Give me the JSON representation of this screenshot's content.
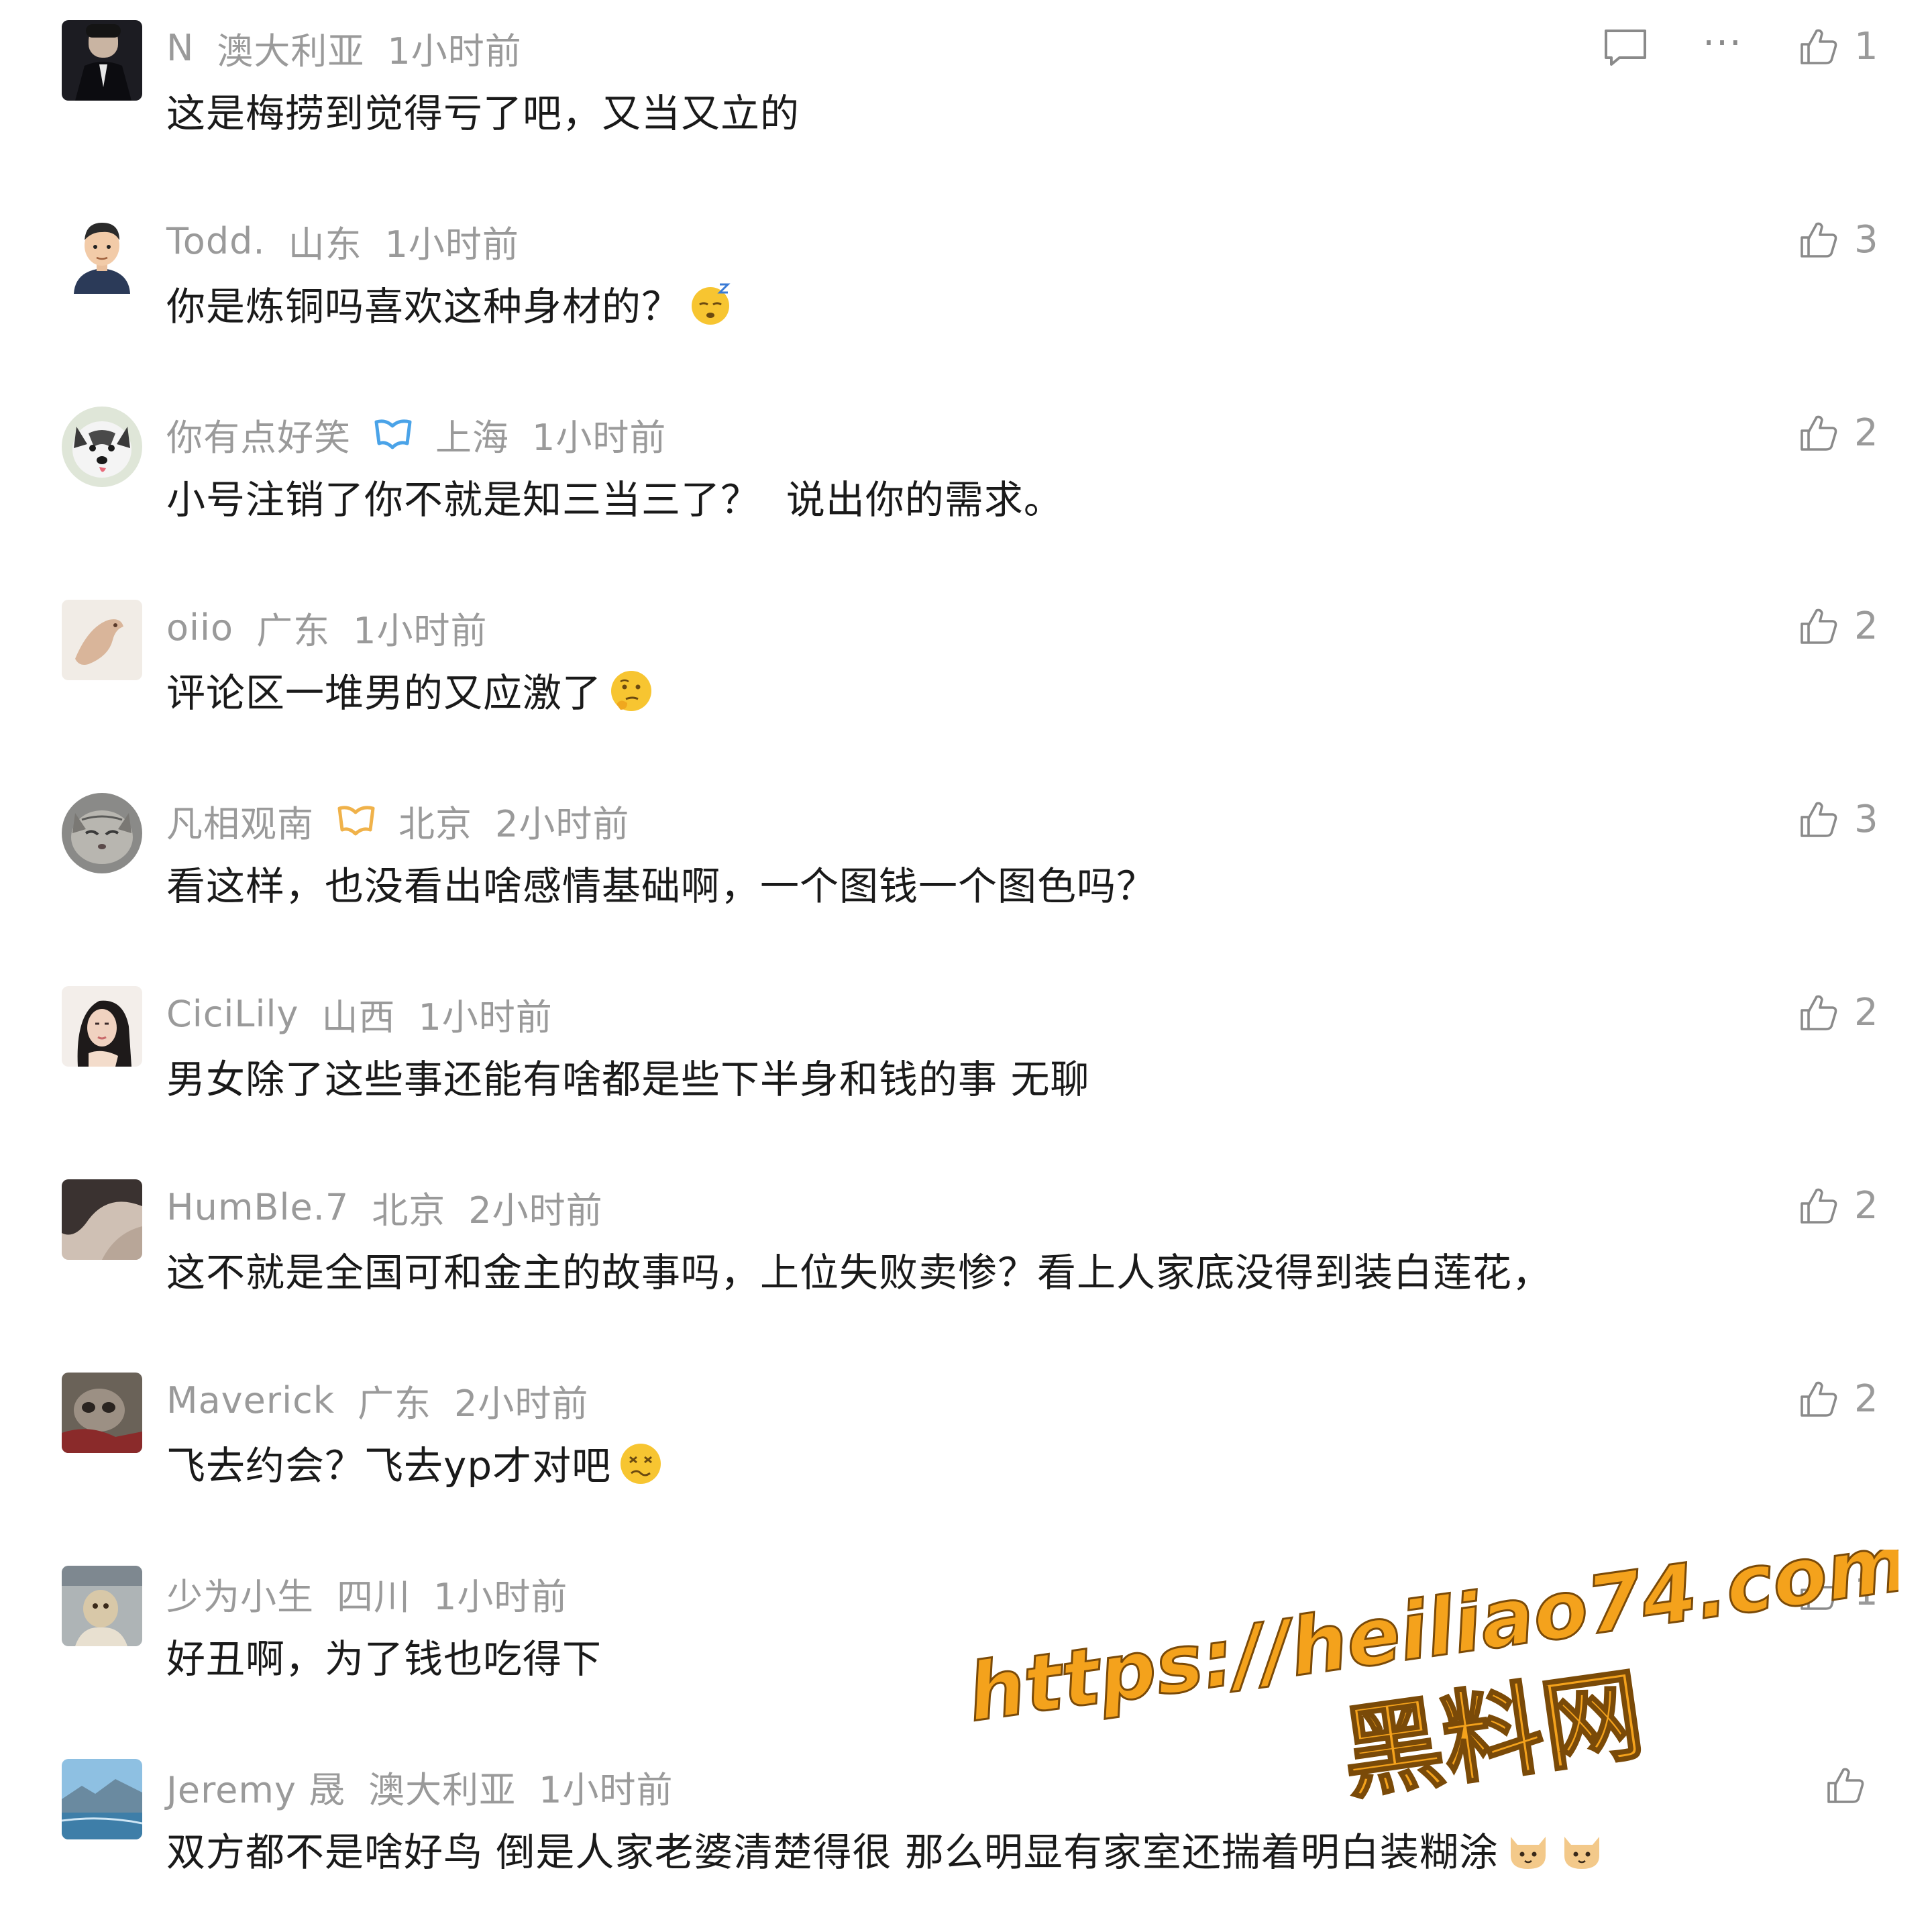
{
  "comments": [
    {
      "username": "N",
      "location": "澳大利亚",
      "time": "1小时前",
      "text": "这是梅捞到觉得亏了吧，又当又立的",
      "likes": "1",
      "badge": "",
      "emoji": ""
    },
    {
      "username": "Todd.",
      "location": "山东",
      "time": "1小时前",
      "text": "你是炼铜吗喜欢这种身材的？",
      "likes": "3",
      "badge": "",
      "emoji": "sleepy-face-emoji"
    },
    {
      "username": "你有点好笑",
      "location": "上海",
      "time": "1小时前",
      "text": "小号注销了你不就是知三当三了？  说出你的需求。",
      "likes": "2",
      "badge": "vip-badge-blue",
      "emoji": ""
    },
    {
      "username": "oiio",
      "location": "广东",
      "time": "1小时前",
      "text": "评论区一堆男的又应激了",
      "likes": "2",
      "badge": "",
      "emoji": "thinking-face-emoji"
    },
    {
      "username": "凡相观南",
      "location": "北京",
      "time": "2小时前",
      "text": "看这样，也没看出啥感情基础啊，一个图钱一个图色吗？",
      "likes": "3",
      "badge": "vip-badge-gold",
      "emoji": ""
    },
    {
      "username": "CiciLily",
      "location": "山西",
      "time": "1小时前",
      "text": "男女除了这些事还能有啥都是些下半身和钱的事 无聊",
      "likes": "2",
      "badge": "",
      "emoji": ""
    },
    {
      "username": "HumBle.7",
      "location": "北京",
      "time": "2小时前",
      "text": "这不就是全国可和金主的故事吗，上位失败卖惨？看上人家底没得到装白莲花，",
      "likes": "2",
      "badge": "",
      "emoji": ""
    },
    {
      "username": "Maverick",
      "location": "广东",
      "time": "2小时前",
      "text": "飞去约会？飞去yp才对吧",
      "likes": "2",
      "badge": "",
      "emoji": "dizzy-face-emoji"
    },
    {
      "username": "少为小生",
      "location": "四川",
      "time": "1小时前",
      "text": "好丑啊，为了钱也吃得下",
      "likes": "1",
      "badge": "",
      "emoji": ""
    },
    {
      "username": "Jeremy 晟",
      "location": "澳大利亚",
      "time": "1小时前",
      "text": "双方都不是啥好鸟 倒是人家老婆清楚得很 那么明显有家室还揣着明白装糊涂",
      "likes": "",
      "badge": "",
      "emoji": "cat-face-emoji"
    }
  ],
  "icons": {
    "like": "thumbs-up-icon",
    "reply": "comment-bubble-icon",
    "more": "more-dots-icon"
  },
  "more_label": "···",
  "watermark": {
    "url": "https://heiliao74.com",
    "name": "黑料网",
    "color": "#f4a21c"
  },
  "colors": {
    "meta": "#9a9a9a",
    "text": "#1a1a1a",
    "vip_blue": "#4aa3e8",
    "vip_gold": "#f0b24a"
  }
}
